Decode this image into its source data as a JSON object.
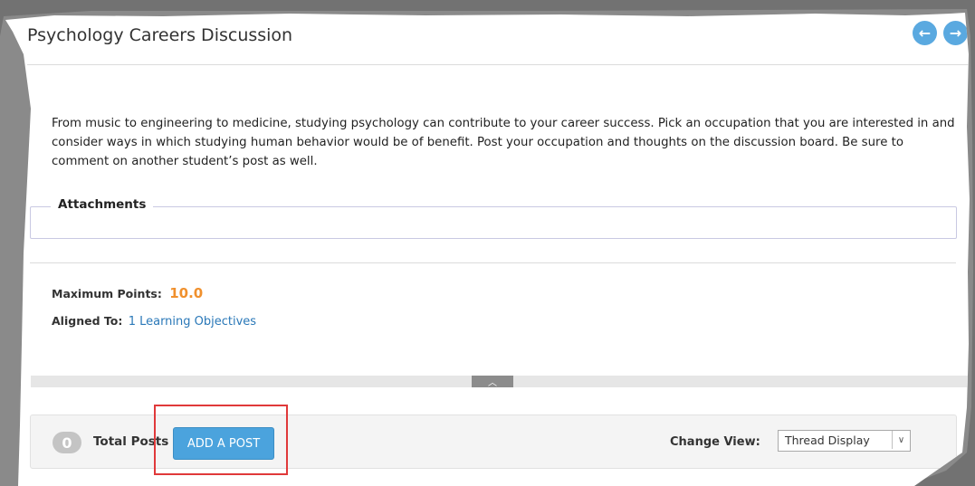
{
  "header": {
    "title": "Psychology Careers Discussion",
    "prev_icon": "arrow-left-icon",
    "next_icon": "arrow-right-icon",
    "prev_glyph": "←",
    "next_glyph": "→"
  },
  "description": "From music to engineering to medicine, studying psychology can contribute to your career success. Pick an occupation that you are interested in and consider ways in which studying human behavior would be of benefit. Post your occupation and thoughts on the discussion board. Be sure to comment on another student’s post as well.",
  "attachments": {
    "legend": "Attachments"
  },
  "meta": {
    "max_points_label": "Maximum Points:",
    "max_points_value": "10.0",
    "aligned_label": "Aligned To:",
    "aligned_value": "1 Learning Objectives"
  },
  "collapse": {
    "icon": "chevron-up-icon",
    "glyph": "︿"
  },
  "toolbar": {
    "post_count": "0",
    "total_label": "Total Posts",
    "add_button": "ADD A POST",
    "change_view_label": "Change View:",
    "view_selected": "Thread Display",
    "select_icon": "chevron-down-icon"
  },
  "colors": {
    "accent": "#4ba3dd",
    "points": "#f0902d",
    "link": "#2a78b8",
    "highlight": "#e0393a"
  }
}
